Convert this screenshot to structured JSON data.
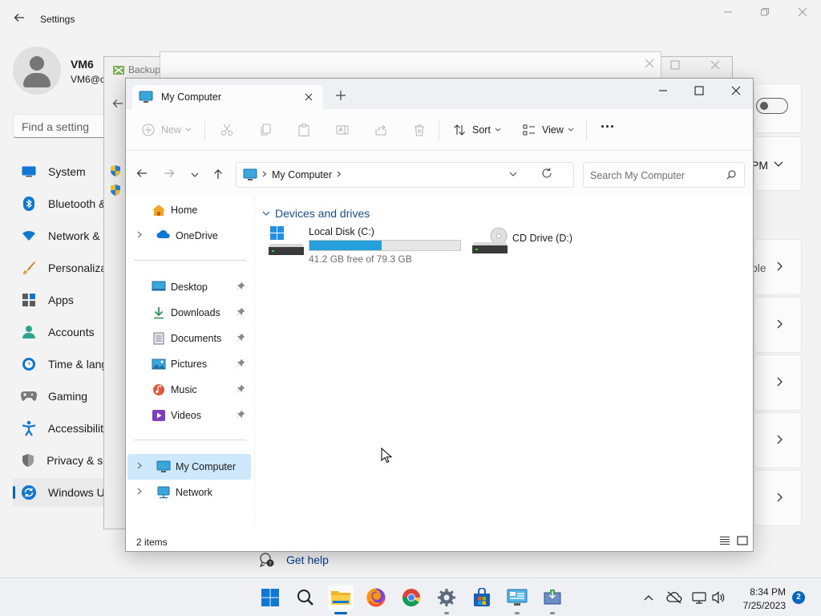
{
  "settings": {
    "title": "Settings",
    "user": {
      "name": "VM6",
      "email": "VM6@c"
    },
    "search_placeholder": "Find a setting",
    "nav": [
      {
        "label": "System",
        "icon": "system-icon"
      },
      {
        "label": "Bluetooth &",
        "icon": "bluetooth-icon"
      },
      {
        "label": "Network &",
        "icon": "network-icon"
      },
      {
        "label": "Personaliza",
        "icon": "brush-icon"
      },
      {
        "label": "Apps",
        "icon": "apps-icon"
      },
      {
        "label": "Accounts",
        "icon": "accounts-icon"
      },
      {
        "label": "Time & lang",
        "icon": "clock-icon"
      },
      {
        "label": "Gaming",
        "icon": "gamepad-icon"
      },
      {
        "label": "Accessibility",
        "icon": "accessibility-icon"
      },
      {
        "label": "Privacy & se",
        "icon": "shield-icon"
      },
      {
        "label": "Windows U",
        "icon": "update-icon"
      }
    ],
    "right_card_text_1": "PM",
    "right_card_text_2": "ple",
    "get_help": "Get help"
  },
  "behind_window": {
    "title": "Backup"
  },
  "explorer": {
    "tab_title": "My Computer",
    "toolbar": {
      "new_label": "New",
      "sort_label": "Sort",
      "view_label": "View",
      "more_label": "···"
    },
    "address": {
      "crumb": "My Computer"
    },
    "search_placeholder": "Search My Computer",
    "sidebar": {
      "home": "Home",
      "onedrive": "OneDrive",
      "pinned": [
        {
          "label": "Desktop",
          "icon": "desktop-folder-icon"
        },
        {
          "label": "Downloads",
          "icon": "downloads-icon"
        },
        {
          "label": "Documents",
          "icon": "documents-icon"
        },
        {
          "label": "Pictures",
          "icon": "pictures-icon"
        },
        {
          "label": "Music",
          "icon": "music-icon"
        },
        {
          "label": "Videos",
          "icon": "videos-icon"
        }
      ],
      "my_computer": "My Computer",
      "network": "Network"
    },
    "group_header": "Devices and drives",
    "drives": [
      {
        "name": "Local Disk (C:)",
        "free_text": "41.2 GB free of 79.3 GB",
        "used_fraction": 0.48
      },
      {
        "name": "CD Drive (D:)"
      }
    ],
    "status_items": "2 items"
  },
  "taskbar": {
    "apps": [
      "windows-start-icon",
      "search-icon",
      "file-explorer-icon",
      "firefox-icon",
      "chrome-icon",
      "settings-icon",
      "store-icon",
      "control-panel-icon",
      "backup-app-icon"
    ],
    "time": "8:34 PM",
    "date": "7/25/2023",
    "notification_count": "2"
  },
  "colors": {
    "accent": "#0067c0",
    "drive_bar": "#26a0da",
    "group_header": "#1a4e92",
    "selected_nav": "#cde8fb"
  }
}
